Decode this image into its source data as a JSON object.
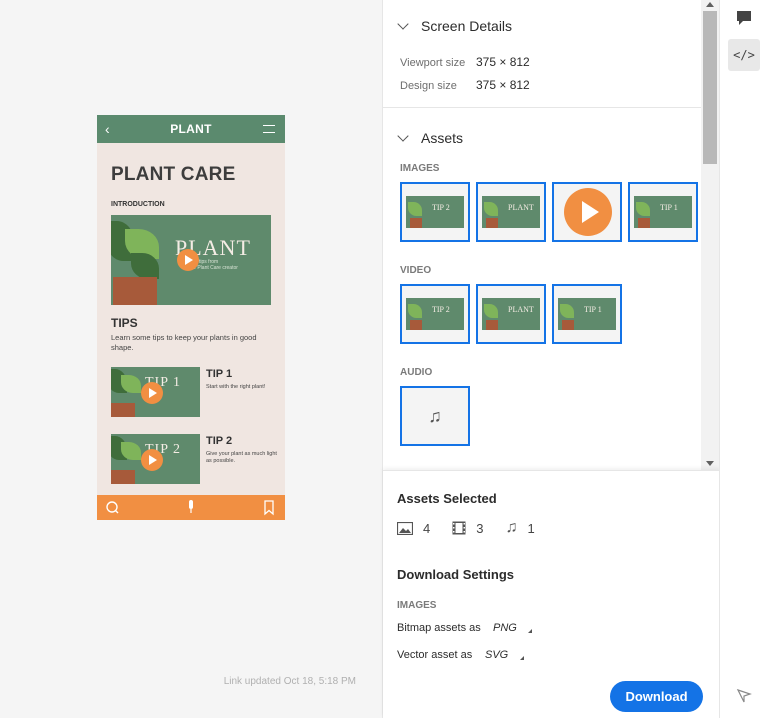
{
  "preview": {
    "header_title": "PLANT",
    "heading": "PLANT CARE",
    "intro_label": "INTRODUCTION",
    "video_title": "PLANT",
    "video_caption": "Fun tips from\nthe Plant Care creator",
    "tips_heading": "TIPS",
    "tips_desc": "Learn some tips to keep your plants in good shape.",
    "tips": [
      {
        "title": "TIP 1",
        "desc": "Start with the right plant!",
        "img_text": "TIP 1"
      },
      {
        "title": "TIP 2",
        "desc": "Give your plant as much light as possible.",
        "img_text": "TIP 2"
      }
    ],
    "footer_icons": [
      "search-icon",
      "microphone-icon",
      "bookmark-icon"
    ]
  },
  "link_updated": "Link updated Oct 18, 5:18 PM",
  "screen_details": {
    "title": "Screen Details",
    "viewport_label": "Viewport size",
    "viewport_value": "375 × 812",
    "design_label": "Design size",
    "design_value": "375 × 812"
  },
  "assets": {
    "title": "Assets",
    "images_label": "IMAGES",
    "images": [
      "TIP 2",
      "PLANT",
      "play",
      "TIP 1"
    ],
    "video_label": "VIDEO",
    "videos": [
      "TIP 2",
      "PLANT",
      "TIP 1"
    ],
    "audio_label": "AUDIO"
  },
  "assets_selected": {
    "title": "Assets Selected",
    "images_count": "4",
    "video_count": "3",
    "audio_count": "1"
  },
  "download_settings": {
    "title": "Download Settings",
    "images_label": "IMAGES",
    "bitmap_label": "Bitmap assets as",
    "bitmap_value": "PNG",
    "vector_label": "Vector asset as",
    "vector_value": "SVG",
    "button": "Download"
  },
  "colors": {
    "accent": "#1473e6",
    "green": "#5b8a6e",
    "orange": "#f18f42",
    "phone_bg": "#f0e6e1"
  }
}
